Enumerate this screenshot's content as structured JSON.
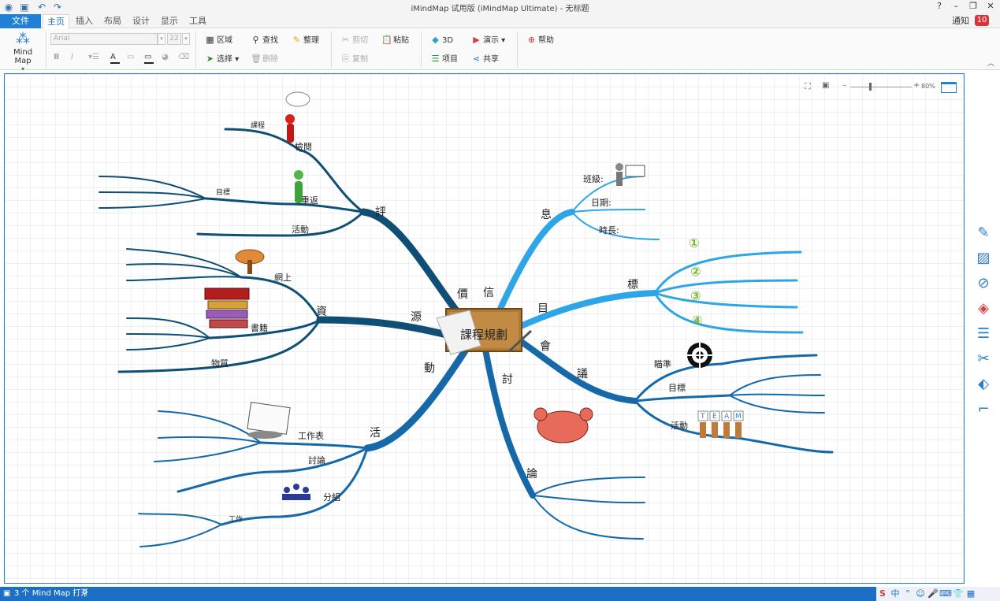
{
  "window": {
    "title": "iMindMap 试用版 (iMindMap Ultimate) - 无标题",
    "help": "?",
    "minimize": "–",
    "restore": "❐",
    "close": "✕"
  },
  "tabs": [
    "文件",
    "主页",
    "插入",
    "布局",
    "设计",
    "显示",
    "工具"
  ],
  "notify": {
    "label": "通知",
    "count": "10"
  },
  "ribbon": {
    "mindmap_label": "Mind Map",
    "font_name": "Arial",
    "font_size": "22",
    "format": [
      "B",
      "I"
    ],
    "group1": [
      {
        "icon": "▦",
        "label": "区域"
      },
      {
        "icon": "⚲",
        "label": "查找"
      },
      {
        "icon": "✎",
        "label": "整理"
      },
      {
        "icon": "➤",
        "label": "选择 ▾"
      },
      {
        "icon": "🗑",
        "label": "删除"
      }
    ],
    "group2": [
      {
        "icon": "✂",
        "label": "剪切"
      },
      {
        "icon": "📋",
        "label": "粘贴"
      },
      {
        "icon": "⎘",
        "label": "复制"
      }
    ],
    "group3": [
      {
        "icon": "◆",
        "label": "3D"
      },
      {
        "icon": "▶",
        "label": "演示 ▾"
      },
      {
        "icon": "☰",
        "label": "项目"
      },
      {
        "icon": "⋖",
        "label": "共享"
      }
    ],
    "group4": [
      {
        "icon": "⊕",
        "label": "帮助"
      }
    ]
  },
  "zoom": {
    "value": "80%",
    "minus": "–",
    "plus": "+"
  },
  "map": {
    "central": "課程規劃",
    "branches": {
      "eval": {
        "label": "評",
        "label2": "價",
        "subs": [
          "檢閱",
          "重返",
          "活動"
        ],
        "leaf": "課程",
        "goal": "目標"
      },
      "info": {
        "label": "息",
        "label2": "信",
        "subs": [
          "班級:",
          "日期:",
          "時長:"
        ]
      },
      "goal": {
        "label": "標",
        "label2": "目",
        "subs": [
          "①",
          "②",
          "③",
          "④"
        ]
      },
      "meeting": {
        "label": "議",
        "label2": "會",
        "subs": [
          "瞄準",
          "目標",
          "活動"
        ],
        "team": [
          "T",
          "E",
          "A",
          "M"
        ]
      },
      "discuss": {
        "label": "論",
        "label2": "討"
      },
      "activity": {
        "label": "活",
        "label2": "動",
        "subs": [
          "工作表",
          "討論",
          "分組"
        ],
        "leaf": "工作"
      },
      "resource": {
        "label": "資",
        "label2": "源",
        "subs": [
          "網上",
          "書籍",
          "物質"
        ]
      }
    }
  },
  "status": {
    "text": "3 个 Mind Map 打开",
    "tray": [
      "S",
      "中",
      "°",
      "☺",
      "🎤",
      "⌨",
      "👕",
      "▦"
    ]
  },
  "colors": {
    "accent": "#1f80d4",
    "dark_branch": "#0f4e75",
    "light_branch": "#2ea5e6",
    "mid_branch": "#1669a8"
  }
}
